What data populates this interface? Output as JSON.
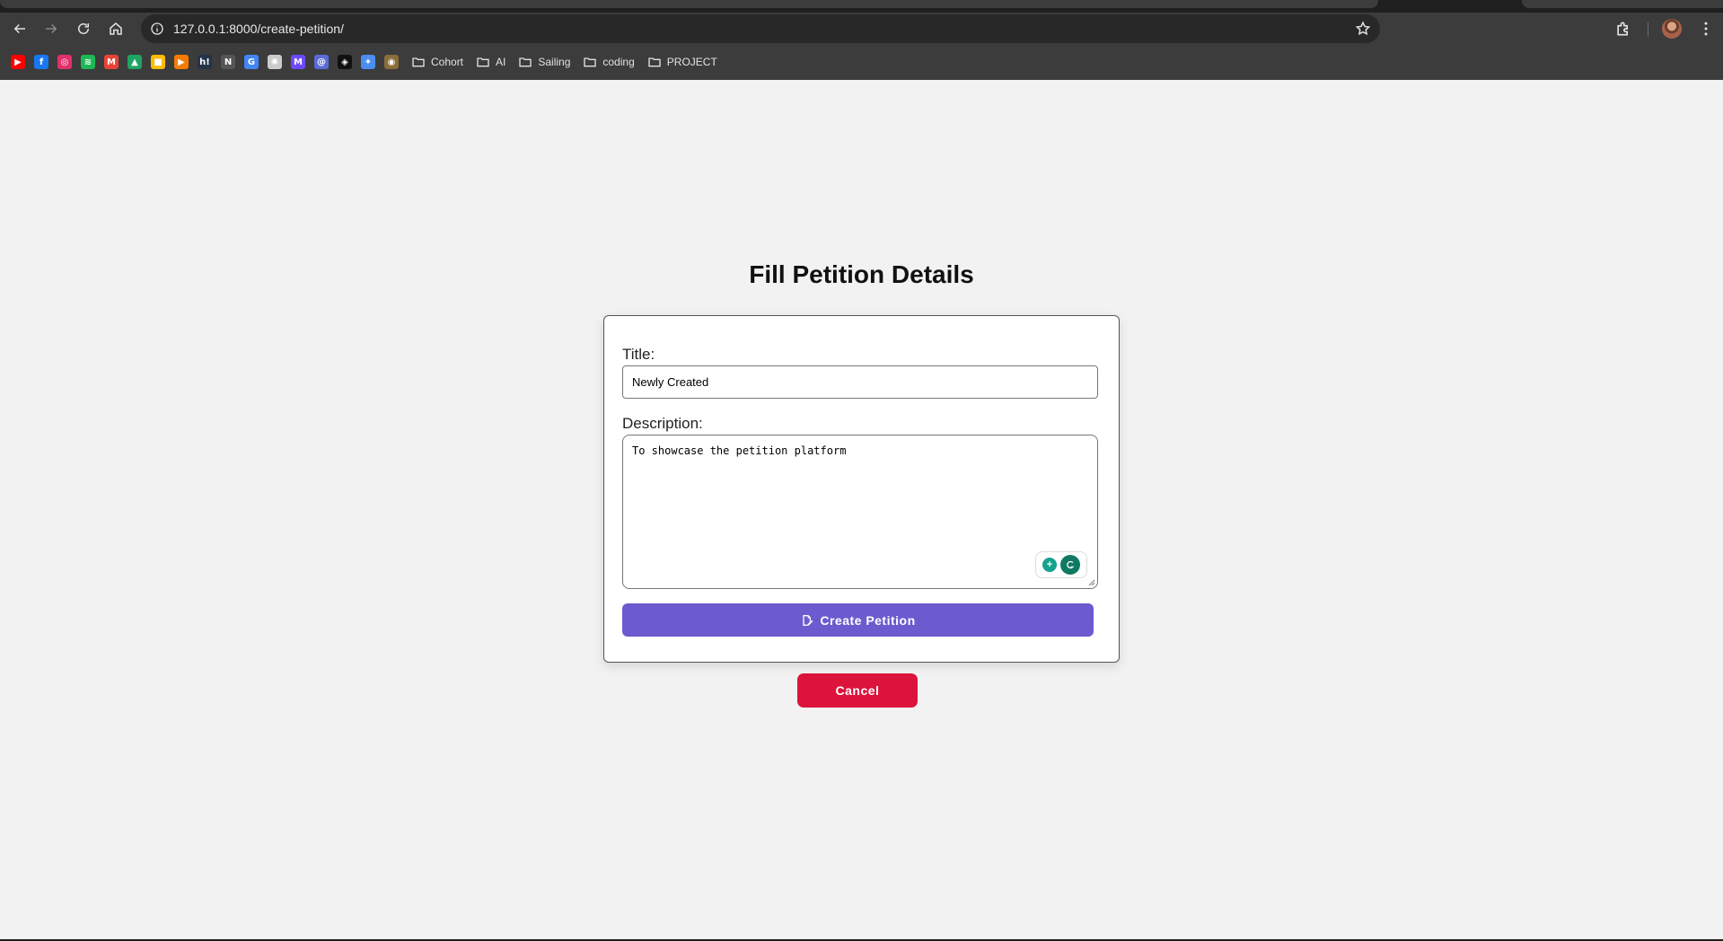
{
  "browser": {
    "url": "127.0.0.1:8000/create-petition/",
    "bookmarks": {
      "icons": [
        {
          "name": "youtube-icon",
          "color": "#ff0000",
          "glyph": "▶"
        },
        {
          "name": "facebook-icon",
          "color": "#1877f2",
          "glyph": "f"
        },
        {
          "name": "instagram-icon",
          "color": "#e1306c",
          "glyph": "◎"
        },
        {
          "name": "spotify-icon",
          "color": "#1db954",
          "glyph": "≋"
        },
        {
          "name": "gmail-icon",
          "color": "#ea4335",
          "glyph": "M"
        },
        {
          "name": "google-drive-icon",
          "color": "#1fa463",
          "glyph": "▲"
        },
        {
          "name": "keep-icon",
          "color": "#fbbc04",
          "glyph": "■"
        },
        {
          "name": "play-icon",
          "color": "#f57c00",
          "glyph": "▶"
        },
        {
          "name": "hackerrank-icon",
          "color": "#243447",
          "glyph": "h!"
        },
        {
          "name": "notion-icon",
          "color": "#555555",
          "glyph": "N"
        },
        {
          "name": "google-icon",
          "color": "#4285f4",
          "glyph": "G"
        },
        {
          "name": "openai-icon",
          "color": "#cccccc",
          "glyph": "✺"
        },
        {
          "name": "proton-mail-icon",
          "color": "#6d4aff",
          "glyph": "M"
        },
        {
          "name": "at-mail-icon",
          "color": "#5b6bd6",
          "glyph": "@"
        },
        {
          "name": "github-icon",
          "color": "#111111",
          "glyph": "◈"
        },
        {
          "name": "gemini-icon",
          "color": "#4a8ef0",
          "glyph": "✦"
        },
        {
          "name": "misc-bookmark-icon",
          "color": "#8a6d3b",
          "glyph": "◉"
        }
      ],
      "folders": [
        "Cohort",
        "AI",
        "Sailing",
        "coding",
        "PROJECT"
      ]
    }
  },
  "page": {
    "heading": "Fill Petition Details",
    "form": {
      "title_label": "Title:",
      "title_value": "Newly Created",
      "description_label": "Description:",
      "description_value": "To showcase the petition platform",
      "create_label": "Create Petition"
    },
    "cancel_label": "Cancel"
  },
  "colors": {
    "create_button": "#6b5bcf",
    "cancel_button": "#dc143c",
    "page_background": "#f2f2f2"
  }
}
